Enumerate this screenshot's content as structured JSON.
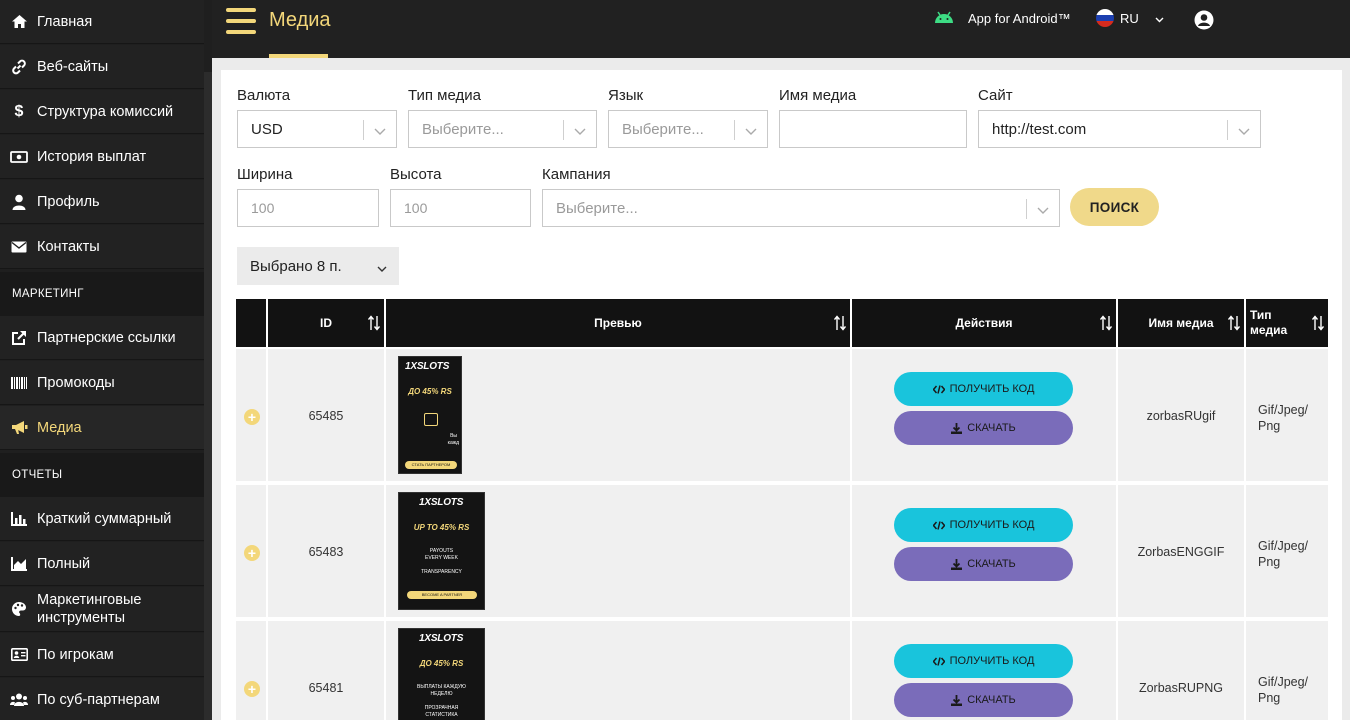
{
  "sidebar": {
    "items": [
      {
        "label": "Главная",
        "icon": "home-icon"
      },
      {
        "label": "Веб-сайты",
        "icon": "link-icon"
      },
      {
        "label": "Структура комиссий",
        "icon": "dollar-icon"
      },
      {
        "label": "История выплат",
        "icon": "money-icon"
      },
      {
        "label": "Профиль",
        "icon": "user-icon"
      },
      {
        "label": "Контакты",
        "icon": "envelope-icon"
      }
    ],
    "section_marketing": "МАРКЕТИНГ",
    "marketing_items": [
      {
        "label": "Партнерские ссылки",
        "icon": "external-link-icon"
      },
      {
        "label": "Промокоды",
        "icon": "barcode-icon"
      },
      {
        "label": "Медиа",
        "icon": "bullhorn-icon",
        "active": true
      }
    ],
    "section_reports": "ОТЧЕТЫ",
    "report_items": [
      {
        "label": "Краткий суммарный",
        "icon": "bar-chart-icon"
      },
      {
        "label": "Полный",
        "icon": "area-chart-icon"
      },
      {
        "label": "Маркетинговые инструменты",
        "icon": "palette-icon"
      },
      {
        "label": "По игрокам",
        "icon": "id-card-icon"
      },
      {
        "label": "По суб-партнерам",
        "icon": "users-icon"
      }
    ]
  },
  "header": {
    "title": "Медиа",
    "android_label": "App for Android™",
    "language": "RU",
    "accent": "#f3d77a"
  },
  "filters": {
    "currency": {
      "label": "Валюта",
      "value": "USD"
    },
    "media_type": {
      "label": "Тип медиа",
      "placeholder": "Выберите..."
    },
    "language": {
      "label": "Язык",
      "placeholder": "Выберите..."
    },
    "media_name": {
      "label": "Имя медиа",
      "value": ""
    },
    "site": {
      "label": "Сайт",
      "value": "http://test.com"
    },
    "width": {
      "label": "Ширина",
      "placeholder": "100"
    },
    "height": {
      "label": "Высота",
      "placeholder": "100"
    },
    "campaign": {
      "label": "Кампания",
      "placeholder": "Выберите..."
    },
    "search_button": "ПОИСК",
    "selected_columns": "Выбрано 8 п."
  },
  "table": {
    "columns": [
      "ID",
      "Превью",
      "Действия",
      "Имя медиа",
      "Тип медиа"
    ],
    "get_code_label": "ПОЛУЧИТЬ КОД",
    "download_label": "СКАЧАТЬ",
    "rows": [
      {
        "id": "65485",
        "name": "zorbasRUgif",
        "type_line1": "Gif/Jpeg/",
        "type_line2": "Png",
        "preview": {
          "brand": "1XSLOTS",
          "headline": "ДО 45% RS",
          "lines": [
            "Вы",
            "кажд"
          ],
          "cta": "СТАТЬ ПАРТНЕРОМ"
        }
      },
      {
        "id": "65483",
        "name": "ZorbasENGGIF",
        "type_line1": "Gif/Jpeg/",
        "type_line2": "Png",
        "preview": {
          "brand": "1XSLOTS",
          "headline": "UP TO 45% RS",
          "lines": [
            "PAYOUTS",
            "EVERY WEEK",
            "TRANSPARENCY"
          ],
          "cta": "BECOME A PARTNER"
        }
      },
      {
        "id": "65481",
        "name": "ZorbasRUPNG",
        "type_line1": "Gif/Jpeg/",
        "type_line2": "Png",
        "preview": {
          "brand": "1XSLOTS",
          "headline": "ДО 45% RS",
          "lines": [
            "ВЫПЛАТЫ КАЖДУЮ",
            "НЕДЕЛЮ",
            "ПРОЗРАЧНАЯ",
            "СТАТИСТИКА"
          ],
          "cta": ""
        }
      }
    ]
  }
}
